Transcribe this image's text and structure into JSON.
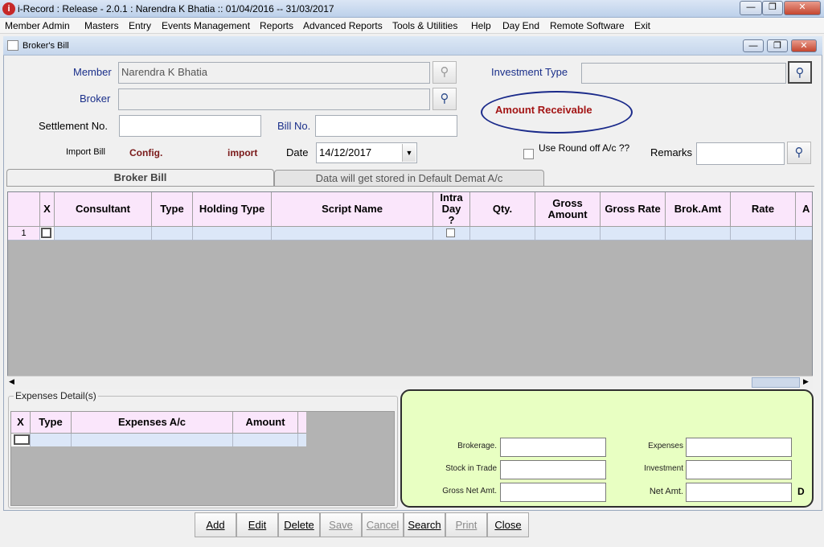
{
  "window": {
    "title": "i-Record : Release - 2.0.1 : Narendra K Bhatia :: 01/04/2016 -- 31/03/2017"
  },
  "menu": [
    "Member Admin",
    "Masters",
    "Entry",
    "Events Management",
    "Reports",
    "Advanced Reports",
    "Tools & Utilities",
    "Help",
    "Day End",
    "Remote Software",
    "Exit"
  ],
  "child": {
    "title": "Broker's Bill"
  },
  "form": {
    "member_label": "Member",
    "member_value": "Narendra K Bhatia",
    "broker_label": "Broker",
    "broker_value": "",
    "investment_type_label": "Investment Type",
    "settlement_label": "Settlement No.",
    "bill_no_label": "Bill No.",
    "amount_status": "Amount Receivable",
    "import_bill_label": "Import Bill",
    "config_link": "Config.",
    "import_link": "import",
    "date_label": "Date",
    "date_value": "14/12/2017",
    "round_off_label": "Use Round off A/c ??",
    "remarks_label": "Remarks"
  },
  "tabs": [
    "Broker Bill",
    "Data will get stored in Default Demat A/c"
  ],
  "grid": {
    "columns": [
      "X",
      "Consultant",
      "Type",
      "Holding Type",
      "Script Name",
      "Intra Day ?",
      "Qty.",
      "Gross Amount",
      "Gross Rate",
      "Brok.Amt",
      "Rate",
      "A"
    ],
    "row_number": "1"
  },
  "expenses": {
    "legend": "Expenses Detail(s)",
    "columns": [
      "X",
      "Type",
      "Expenses A/c",
      "Amount"
    ]
  },
  "summary": {
    "brokerage": "Brokerage.",
    "stock_in_trade": "Stock in Trade",
    "gross_net_amt": "Gross Net Amt.",
    "expenses": "Expenses",
    "investment": "Investment",
    "net_amt": "Net Amt.",
    "dc": "D"
  },
  "buttons": {
    "add": "Add",
    "edit": "Edit",
    "delete": "Delete",
    "save": "Save",
    "cancel": "Cancel",
    "search": "Search",
    "print": "Print",
    "close": "Close"
  },
  "colors": {
    "grid_header": "#fae6fb",
    "grid_row": "#dce7f8",
    "summary_bg": "#e8ffc2",
    "status_text": "#a31515"
  }
}
